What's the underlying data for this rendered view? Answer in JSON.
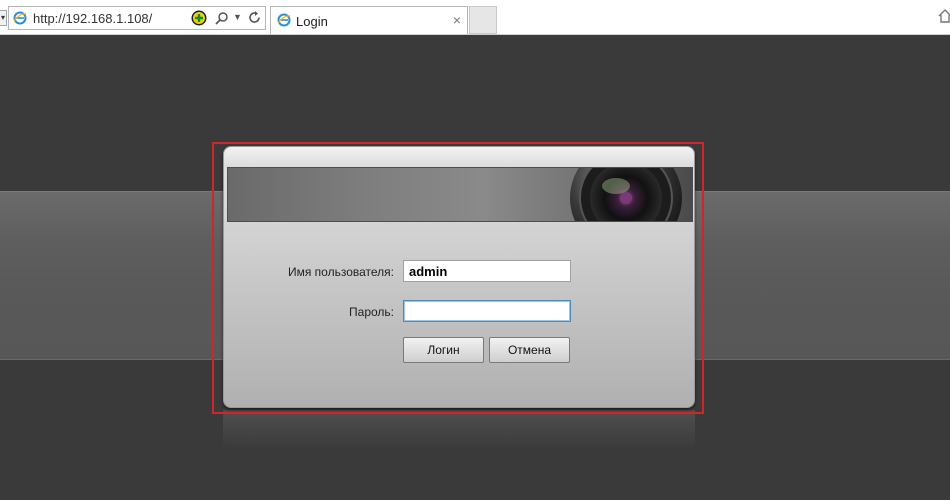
{
  "browser": {
    "url": "http://192.168.1.108/",
    "tab_title": "Login",
    "tab_close": "×",
    "icons": [
      "ie-icon",
      "go-icon",
      "search-icon",
      "dropdown-icon",
      "refresh-icon",
      "home-icon"
    ]
  },
  "login": {
    "username_label": "Имя пользователя:",
    "username_value": "admin",
    "password_label": "Пароль:",
    "password_value": "",
    "login_button": "Логин",
    "cancel_button": "Отмена"
  },
  "colors": {
    "page_bg": "#3a3a3a",
    "highlight_border": "#d0252b",
    "focus_border": "#4a8bc2"
  }
}
